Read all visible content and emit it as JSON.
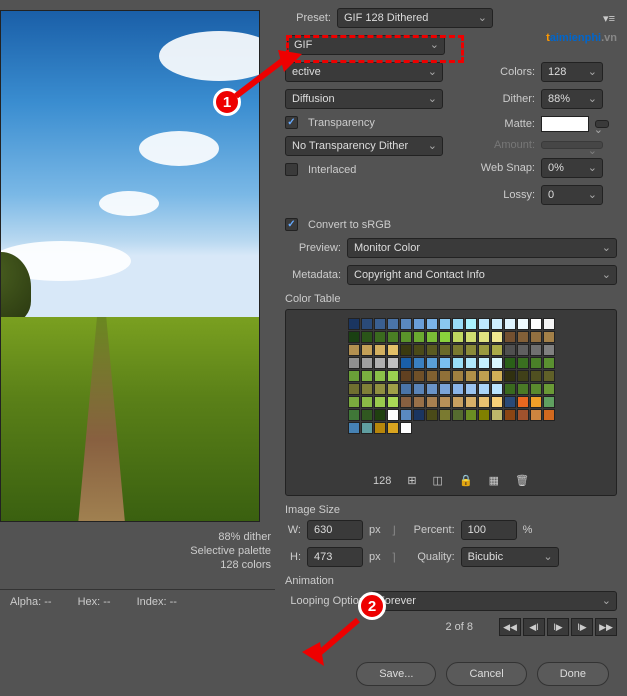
{
  "preset": {
    "label": "Preset:",
    "value": "GIF 128 Dithered"
  },
  "format": {
    "value": "GIF"
  },
  "settingsL": {
    "colorReduction": "ective",
    "dither": "Diffusion",
    "transparencyChk": true,
    "transparencyLbl": "Transparency",
    "transDither": "No Transparency Dither",
    "interlacedChk": false,
    "interlacedLbl": "Interlaced"
  },
  "settingsR": {
    "colorsLbl": "Colors:",
    "colorsVal": "128",
    "ditherLbl": "Dither:",
    "ditherVal": "88%",
    "matteLbl": "Matte:",
    "matteColor": "#ffffff",
    "amountLbl": "Amount:",
    "amountVal": "",
    "websnapLbl": "Web Snap:",
    "websnapVal": "0%",
    "lossyLbl": "Lossy:",
    "lossyVal": "0"
  },
  "convert": {
    "chk": true,
    "lbl": "Convert to sRGB"
  },
  "preview": {
    "lbl": "Preview:",
    "val": "Monitor Color"
  },
  "metadata": {
    "lbl": "Metadata:",
    "val": "Copyright and Contact Info"
  },
  "colorTable": {
    "lbl": "Color Table",
    "count": "128"
  },
  "imageSize": {
    "lbl": "Image Size",
    "wLbl": "W:",
    "wVal": "630",
    "px": "px",
    "hLbl": "H:",
    "hVal": "473",
    "percentLbl": "Percent:",
    "percentVal": "100",
    "pct": "%",
    "qualityLbl": "Quality:",
    "qualityVal": "Bicubic"
  },
  "animation": {
    "lbl": "Animation",
    "loopLbl": "Looping Option",
    "loopVal": "Forever",
    "frameLbl": "2 of 8"
  },
  "info": {
    "l1": "88% dither",
    "l2": "Selective palette",
    "l3": "128 colors"
  },
  "status": {
    "alpha": "Alpha: --",
    "hex": "Hex: --",
    "index": "Index: --"
  },
  "buttons": {
    "save": "Save...",
    "cancel": "Cancel",
    "done": "Done"
  },
  "logo": {
    "t": "t",
    "rest": "aimienphi",
    "suf": ".vn"
  },
  "colors": [
    "#1a3560",
    "#2a4a78",
    "#3a5f90",
    "#4a74a8",
    "#5a89c0",
    "#6a9ed8",
    "#7ab3e8",
    "#8ac8f0",
    "#9addf8",
    "#aaf2ff",
    "#bfe8ff",
    "#cfeeff",
    "#dff4ff",
    "#effaff",
    "#ffffff",
    "#f5f5f5",
    "#1a4012",
    "#2a5518",
    "#3a6a1e",
    "#4a7f24",
    "#5a942a",
    "#6aa930",
    "#7abe36",
    "#8ad33c",
    "#c0d860",
    "#d0dd70",
    "#e0e280",
    "#f0e790",
    "#735030",
    "#836038",
    "#937040",
    "#a38048",
    "#b39050",
    "#c3a058",
    "#d3b060",
    "#e3c068",
    "#3a3a10",
    "#4a4a18",
    "#5a5a20",
    "#6a6a28",
    "#7a7a30",
    "#8a8a38",
    "#9a9a40",
    "#aaaa48",
    "#505050",
    "#606060",
    "#707070",
    "#808080",
    "#909090",
    "#a0a0a0",
    "#b0b0b0",
    "#c0c0c0",
    "#1a5fa8",
    "#3a7fc0",
    "#5a9fd8",
    "#7abff0",
    "#9adff8",
    "#b0e8fc",
    "#c5f0fe",
    "#daf8ff",
    "#2a6018",
    "#3a7020",
    "#4a8028",
    "#5a9030",
    "#6aa038",
    "#7ab040",
    "#8ac048",
    "#9ad050",
    "#604020",
    "#705028",
    "#806030",
    "#907038",
    "#a08040",
    "#b09048",
    "#c0a050",
    "#d0b058",
    "#303010",
    "#404018",
    "#505020",
    "#606028",
    "#707030",
    "#808038",
    "#909040",
    "#a0a048",
    "#4a74a8",
    "#5a84b8",
    "#6a94c8",
    "#7aa4d8",
    "#8ab4e8",
    "#9ac4f0",
    "#aad4f8",
    "#bae4ff",
    "#3a6a1e",
    "#4a7a26",
    "#5a8a2e",
    "#6a9a36",
    "#7aaa3e",
    "#8aba46",
    "#9aca4e",
    "#aada56",
    "#886040",
    "#987048",
    "#a88050",
    "#b89058",
    "#c8a060",
    "#d8b068",
    "#e8c070",
    "#f8d078",
    "#2a4a78",
    "#e86820",
    "#f0a028",
    "#60a060",
    "#407838",
    "#305820",
    "#204010",
    "#ffffff",
    "#5a89c0",
    "#1a3560",
    "#4a4a18",
    "#7a7a30",
    "#556b2f",
    "#6b8e23",
    "#808000",
    "#bdb76b",
    "#8b4513",
    "#a0522d",
    "#cd853f",
    "#d2691e",
    "#4682b4",
    "#5f9ea0",
    "#b8860b",
    "#daa520",
    "#ffffff"
  ]
}
